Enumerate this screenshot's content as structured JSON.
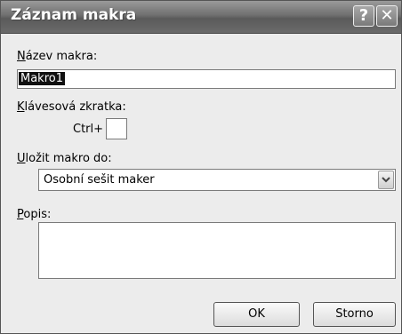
{
  "window": {
    "title": "Záznam makra",
    "help_glyph": "?",
    "close_glyph": "✕"
  },
  "fields": {
    "name_label_key": "N",
    "name_label_rest": "ázev makra:",
    "name_value": "Makro1",
    "shortcut_label_key": "K",
    "shortcut_label_rest": "lávesová zkratka:",
    "shortcut_prefix": "Ctrl+",
    "shortcut_value": "",
    "store_label_key": "U",
    "store_label_rest": "ložit makro do:",
    "store_value": "Osobní sešit maker",
    "desc_label_key": "P",
    "desc_label_rest": "opis:",
    "desc_value": ""
  },
  "buttons": {
    "ok": "OK",
    "cancel": "Storno"
  }
}
